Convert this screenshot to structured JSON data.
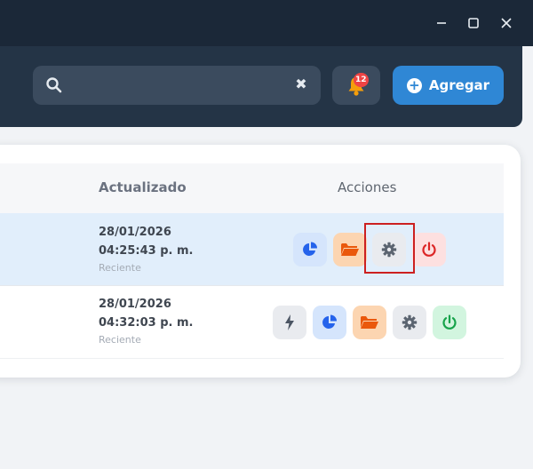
{
  "window": {
    "controls": [
      "minimize-icon",
      "maximize-icon",
      "close-icon"
    ]
  },
  "toolbar": {
    "search": {
      "value": "",
      "placeholder": "",
      "clear_icon": "close-icon"
    },
    "notifications": {
      "icon": "bell-icon",
      "count": "12"
    },
    "add_button": {
      "label": "Agregar",
      "icon": "plus-circle-icon"
    }
  },
  "table": {
    "columns": {
      "updated": "Actualizado",
      "actions": "Acciones"
    },
    "rows": [
      {
        "date": "28/01/2026",
        "time": "04:25:43 p. m.",
        "status": "Reciente",
        "selected": true,
        "actions": [
          "chart-pie-icon",
          "folder-open-icon",
          "gear-icon",
          "power-icon"
        ]
      },
      {
        "date": "28/01/2026",
        "time": "04:32:03 p. m.",
        "status": "Reciente",
        "selected": false,
        "actions": [
          "bolt-icon",
          "chart-pie-icon",
          "folder-open-icon",
          "gear-icon",
          "power-icon"
        ]
      }
    ]
  },
  "colors": {
    "header_bg": "#243446",
    "accent": "#2f87d5",
    "badge": "#ef4444",
    "selected_row": "#e1eefb",
    "highlight": "#cc2020",
    "power_off": "#dc2626",
    "power_on": "#16a34a"
  }
}
